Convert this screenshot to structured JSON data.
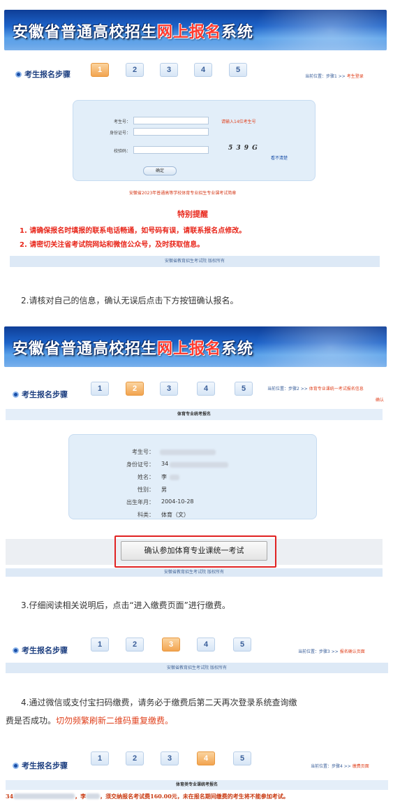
{
  "banner": {
    "prefix": "安徽省普通高校招生",
    "highlight": "网上报名",
    "suffix": "系统"
  },
  "steps": {
    "label": "考生报名步骤",
    "numbers": [
      "1",
      "2",
      "3",
      "4",
      "5"
    ]
  },
  "section1": {
    "active_step": "1",
    "breadcrumb_prefix": "当前位置：步骤1 >> ",
    "breadcrumb_current": "考生登录",
    "form": {
      "exam_no_label": "考生号：",
      "exam_no_hint": "请输入14位考生号",
      "id_label": "身份证号：",
      "captcha_label": "校验码：",
      "captcha_text": "5 3 9 G",
      "refresh_link": "看不清楚",
      "confirm_btn": "确定"
    },
    "notice_link": "安徽省2023年普通高等学校体育专业招生专业课考试简章",
    "special_title": "特别提醒",
    "special_lines": [
      "1. 请确保报名时填报的联系电话畅通，如号码有误，请联系报名点修改。",
      "2. 请密切关注省考试院网站和微信公众号，及时获取信息。"
    ],
    "footer": "安徽省教育招生考试院 版权所有"
  },
  "instruction2": "2.请核对自己的信息，确认无误后点击下方按钮确认报名。",
  "section2": {
    "active_step": "2",
    "breadcrumb_prefix": "当前位置：步骤2 >> ",
    "breadcrumb_current": "体育专业课统一考试报名信息",
    "breadcrumb_tail": "确认",
    "bar_title": "体育专业统考报名",
    "info": {
      "exam_no_label": "考生号：",
      "id_label": "身份证号：",
      "id_value": "34",
      "name_label": "姓名：",
      "name_value": "李",
      "gender_label": "性别：",
      "gender_value": "男",
      "birth_label": "出生年月：",
      "birth_value": "2004-10-28",
      "category_label": "科类：",
      "category_value": "体育（文）"
    },
    "confirm_btn": "确认参加体育专业课统一考试",
    "footer": "安徽省教育招生考试院 版权所有"
  },
  "instruction3": "3.仔细阅读相关说明后，点击“进入缴费页面”进行缴费。",
  "section3": {
    "active_step": "3",
    "breadcrumb_prefix": "当前位置：步骤3 >> ",
    "breadcrumb_current": "报名确认页面",
    "footer": "安徽省教育招生考试院 版权所有"
  },
  "instruction4": {
    "line1": "4.通过微信或支付宝扫码缴费，请务必于缴费后第二天再次登录系统查询缴",
    "line2_black": "费是否成功。",
    "line2_red": "切勿频繁刷新二维码重复缴费。"
  },
  "section4": {
    "active_step": "4",
    "breadcrumb_prefix": "当前位置：步骤4 >> ",
    "breadcrumb_current": "缴费页面",
    "bar_title": "体育类专业课统考报名",
    "pay_prefix": "34",
    "pay_name": "，李",
    "pay_text": "，须交纳报名考试费160.00元，未在报名期间缴费的考生将不能参加考试。"
  },
  "colors": {
    "accent_red": "#e8261a",
    "brand_blue": "#1d3f80",
    "active_step": "#f2a450"
  }
}
